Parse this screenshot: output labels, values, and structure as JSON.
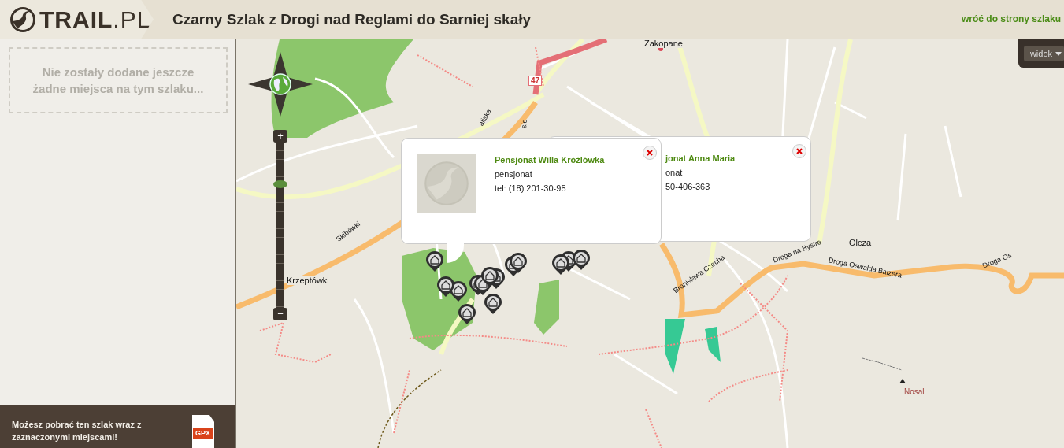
{
  "header": {
    "logo": "**TRAIL**.PL",
    "title": "Czarny Szlak z Drogi nad Reglami do Sarniej skały",
    "back_link": "wróć do strony szlaku"
  },
  "sidebar": {
    "empty_message": "Nie zostały dodane jeszcze żadne miejsca na tym szlaku...",
    "download_text": "Możesz pobrać ten szlak wraz z zaznaczonymi miejscami!",
    "download_badge": "GPX"
  },
  "map": {
    "view_button": "widok",
    "zoom": {
      "plus": "+",
      "minus": "−",
      "level": 0.75
    },
    "labels": [
      {
        "text": "Zakopane",
        "kind": "place"
      },
      {
        "text": "47",
        "kind": "road_number"
      },
      {
        "text": "aliska",
        "kind": "street"
      },
      {
        "text": "sie",
        "kind": "street"
      },
      {
        "text": "Skibówki",
        "kind": "street"
      },
      {
        "text": "Krzeptówki",
        "kind": "place"
      },
      {
        "text": "Olcza",
        "kind": "place"
      },
      {
        "text": "Droga na Bystre",
        "kind": "street"
      },
      {
        "text": "Droga Oswalda Balzera",
        "kind": "street"
      },
      {
        "text": "Bronisława Czecha",
        "kind": "street"
      },
      {
        "text": "Droga Os",
        "kind": "street"
      },
      {
        "text": "Nosal",
        "kind": "peak"
      }
    ],
    "popups": [
      {
        "title": "Pensjonat Willa Króżlówka",
        "type": "pensjonat",
        "phone": "tel: (18) 201-30-95",
        "has_photo": true
      },
      {
        "title": "jonat Anna Maria",
        "type": "onat",
        "phone": "50-406-363",
        "has_photo": false
      }
    ]
  }
}
